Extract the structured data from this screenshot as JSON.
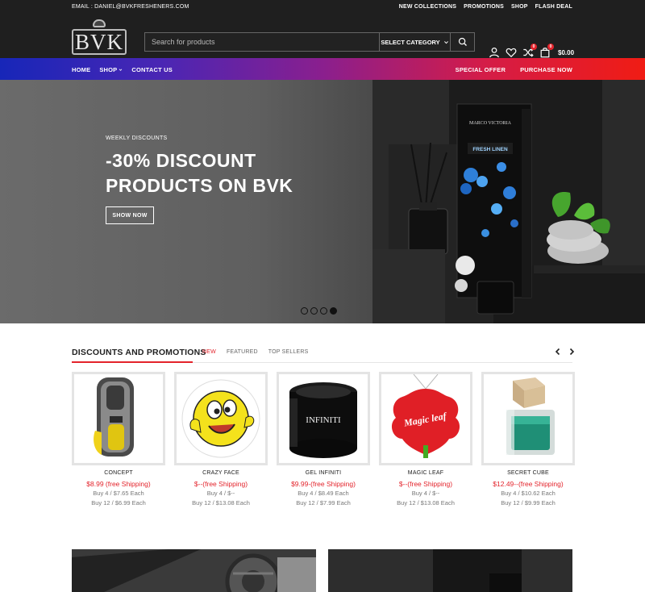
{
  "topbar": {
    "email": "EMAIL : DANIEL@BVKFRESHENERS.COM",
    "links": [
      "NEW COLLECTIONS",
      "PROMOTIONS",
      "SHOP",
      "FLASH DEAL"
    ]
  },
  "header": {
    "logo_text": "BVK",
    "search_placeholder": "Search for products",
    "category_label": "SELECT CATEGORY",
    "compare_count": "0",
    "cart_count": "0",
    "cart_total": "$0.00"
  },
  "nav": {
    "home": "HOME",
    "shop": "SHOP",
    "contact": "CONTACT US",
    "special_offer": "SPECIAL OFFER",
    "purchase_now": "PURCHASE NOW"
  },
  "hero": {
    "pretitle": "WEEKLY DISCOUNTS",
    "title_line1": "-30% DISCOUNT",
    "title_line2": "PRODUCTS ON BVK",
    "button": "SHOW NOW",
    "slide_count": 4,
    "active_slide": 4,
    "box_brand": "MARCO VICTORIA",
    "box_product": "FRESH LINEN"
  },
  "section": {
    "title": "DISCOUNTS AND PROMOTIONS",
    "tabs": [
      "NEW",
      "FEATURED",
      "TOP SELLERS"
    ],
    "active_tab": "NEW"
  },
  "products": [
    {
      "name": "CONCEPT",
      "price": "$8.99 (free Shipping)",
      "tier4": "Buy 4 / $7.65 Each",
      "tier12": "Buy 12 / $6.99 Each",
      "icon": "concept-freshener"
    },
    {
      "name": "CRAZY FACE",
      "price": "$--(free Shipping)",
      "tier4": "Buy 4 / $--",
      "tier12": "Buy 12 / $13.08 Each",
      "icon": "crazy-face-freshener"
    },
    {
      "name": "GEL INFINITI",
      "price": "$9.99-(free Shipping)",
      "tier4": "Buy 4 / $8.49 Each",
      "tier12": "Buy 12 / $7.99 Each",
      "icon": "gel-jar",
      "label_text": "INFINITI"
    },
    {
      "name": "MAGIC LEAF",
      "price": "$--(free Shipping)",
      "tier4": "Buy 4 / $--",
      "tier12": "Buy 12 / $13.08 Each",
      "icon": "magic-leaf-freshener",
      "label_text": "Magic leaf"
    },
    {
      "name": "SECRET CUBE",
      "price": "$12.49--(free Shipping)",
      "tier4": "Buy 4 / $10.62 Each",
      "tier12": "Buy 12 / $9.99  Each",
      "icon": "secret-cube-jar"
    }
  ],
  "colors": {
    "accent": "#e3232b",
    "dark": "#1f1f1f",
    "nav_gradient_start": "#1726b8",
    "nav_gradient_end": "#f01c14"
  }
}
